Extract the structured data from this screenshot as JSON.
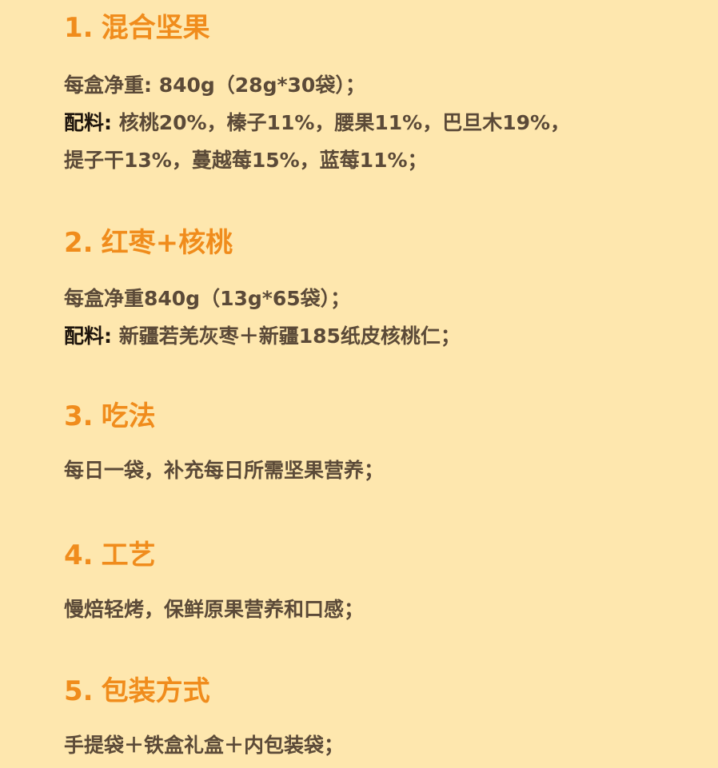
{
  "sections": [
    {
      "num": "1.",
      "title": "混合坚果",
      "lines": [
        {
          "label": "",
          "text": "每盒净重: 840g（28g*30袋）；"
        },
        {
          "label": "配料:",
          "text": " 核桃20%，榛子11%，腰果11%，巴旦木19%，"
        },
        {
          "label": "",
          "text": "提子干13%，蔓越莓15%，蓝莓11%；"
        }
      ]
    },
    {
      "num": "2.",
      "title": "红枣+核桃",
      "lines": [
        {
          "label": "",
          "text": "每盒净重840g（13g*65袋）；"
        },
        {
          "label": "配料:",
          "text": " 新疆若羌灰枣＋新疆185纸皮核桃仁；"
        }
      ]
    },
    {
      "num": "3.",
      "title": "吃法",
      "lines": [
        {
          "label": "",
          "text": "每日一袋，补充每日所需坚果营养；"
        }
      ]
    },
    {
      "num": "4.",
      "title": "工艺",
      "lines": [
        {
          "label": "",
          "text": "慢焙轻烤，保鲜原果营养和口感；"
        }
      ]
    },
    {
      "num": "5.",
      "title": "包装方式",
      "lines": [
        {
          "label": "",
          "text": "手提袋＋铁盒礼盒＋内包装袋；"
        }
      ]
    }
  ]
}
